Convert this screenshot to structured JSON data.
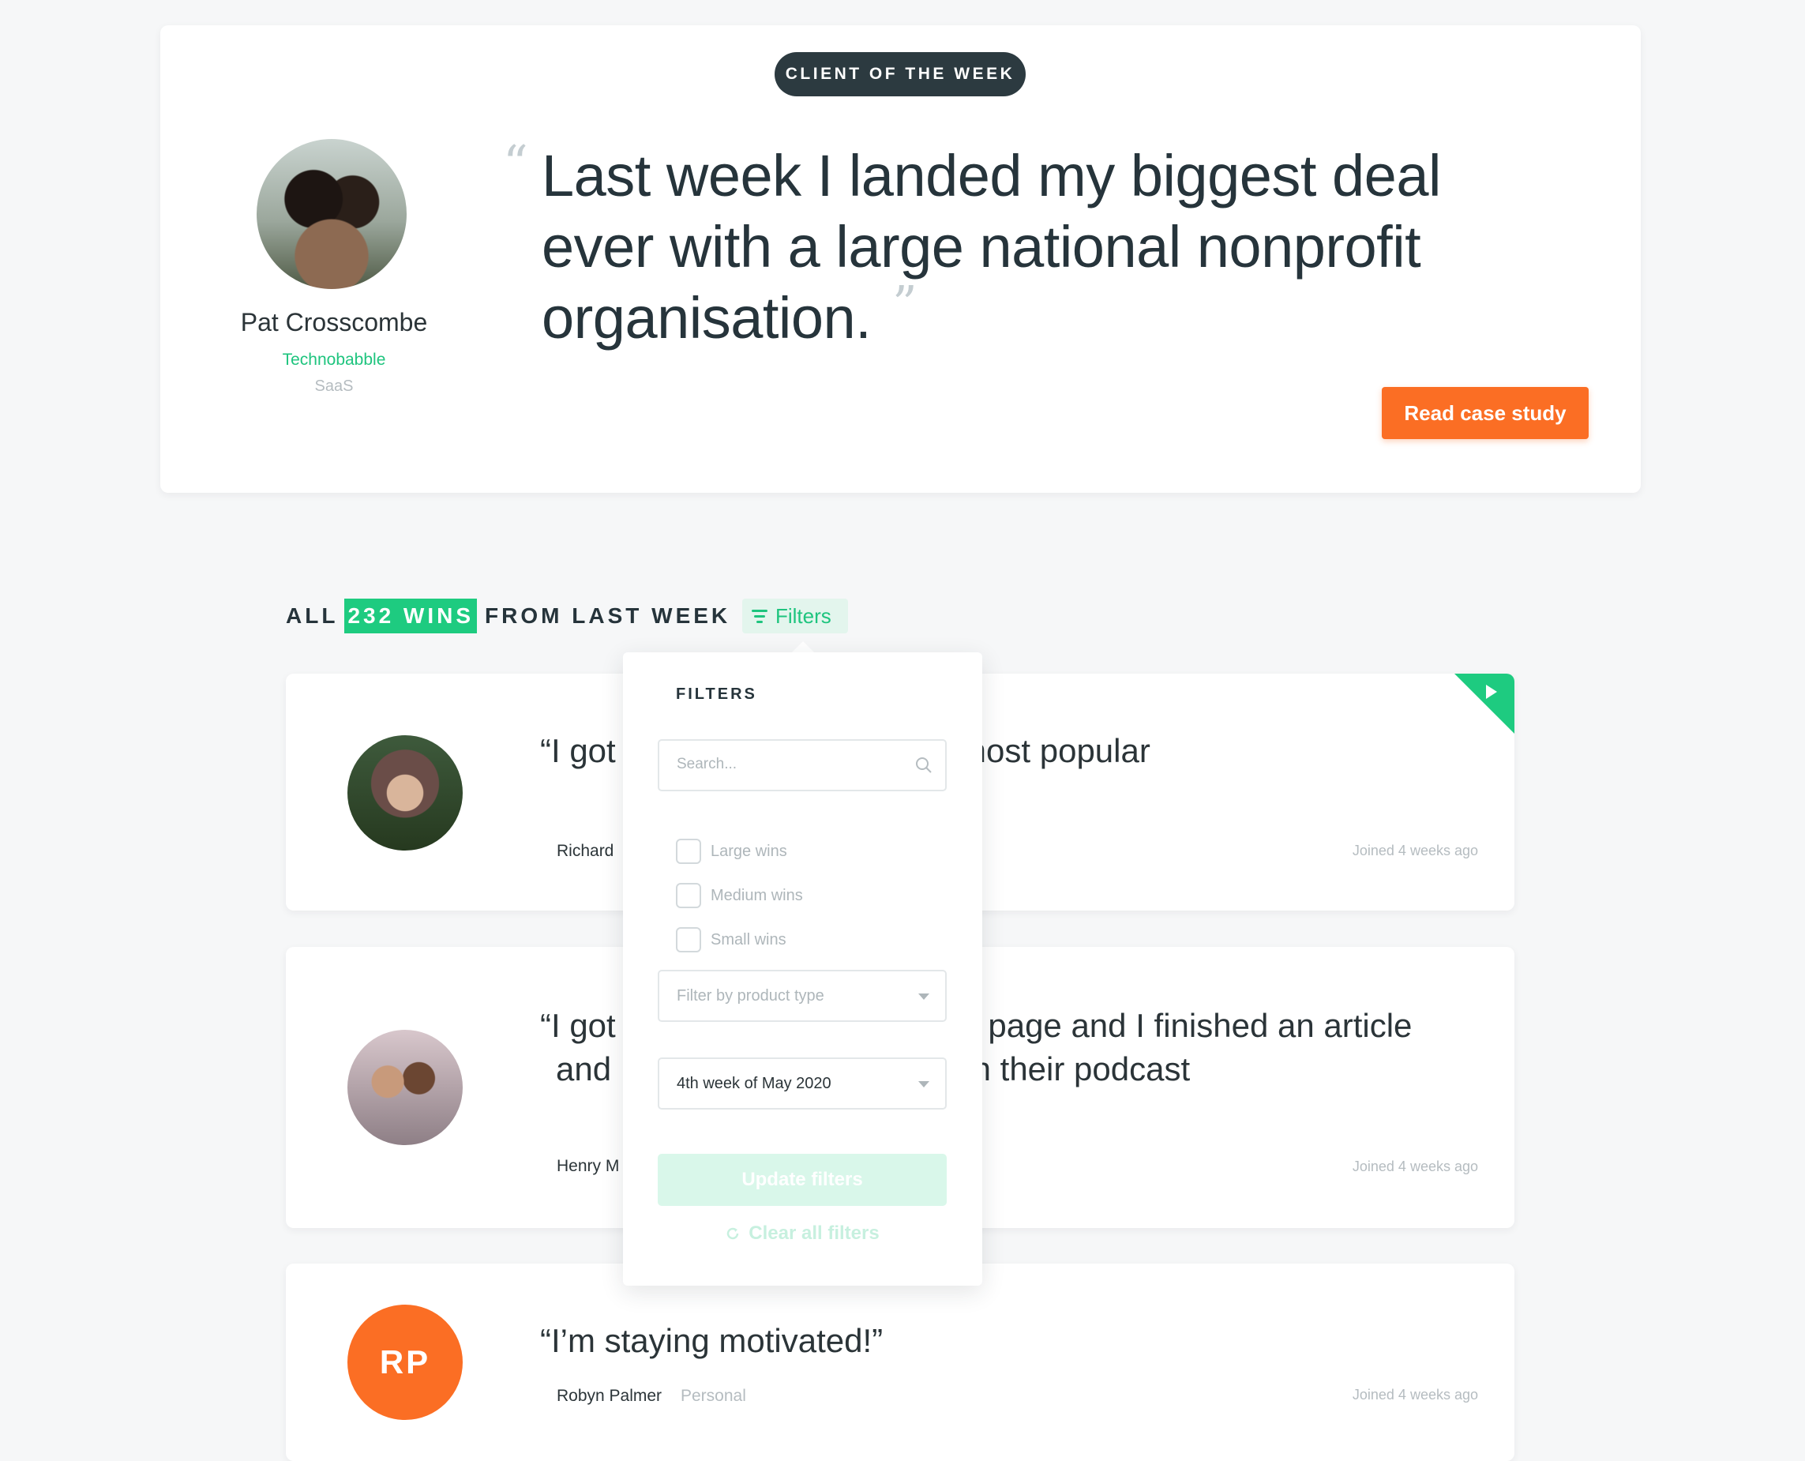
{
  "hero": {
    "badge": "CLIENT OF THE WEEK",
    "quote": "Last week I landed my biggest deal ever with a large national nonprofit organisation.",
    "quote_open": "“",
    "quote_close": "”",
    "name": "Pat Crosscombe",
    "company": "Technobabble",
    "industry": "SaaS",
    "cta_label": "Read case study"
  },
  "wins": {
    "prefix": "ALL",
    "count": "232 WINS",
    "suffix": "FROM LAST WEEK",
    "filters_label": "Filters"
  },
  "cards": [
    {
      "quote": "“I got featured on one of the most popular",
      "author": "Richard",
      "joined": "Joined 4 weeks ago"
    },
    {
      "quote": "“I got a post on their facebook page and I finished an article and I was also interviewed on their podcast",
      "author": "Henry M",
      "joined": "Joined 4 weeks ago"
    },
    {
      "initials": "RP",
      "quote": "“I’m staying motivated!”",
      "author": "Robyn Palmer",
      "category": "Personal",
      "joined": "Joined 4 weeks ago"
    }
  ],
  "filters_panel": {
    "title": "FILTERS",
    "search_placeholder": "Search...",
    "checkboxes": [
      "Large wins",
      "Medium wins",
      "Small wins"
    ],
    "product_type_placeholder": "Filter by product type",
    "week_value": "4th week of May 2020",
    "update_label": "Update filters",
    "clear_label": "Clear all filters"
  },
  "colors": {
    "accent_green": "#1ecb80",
    "accent_orange": "#fb6e24",
    "dark": "#2c3a40"
  }
}
